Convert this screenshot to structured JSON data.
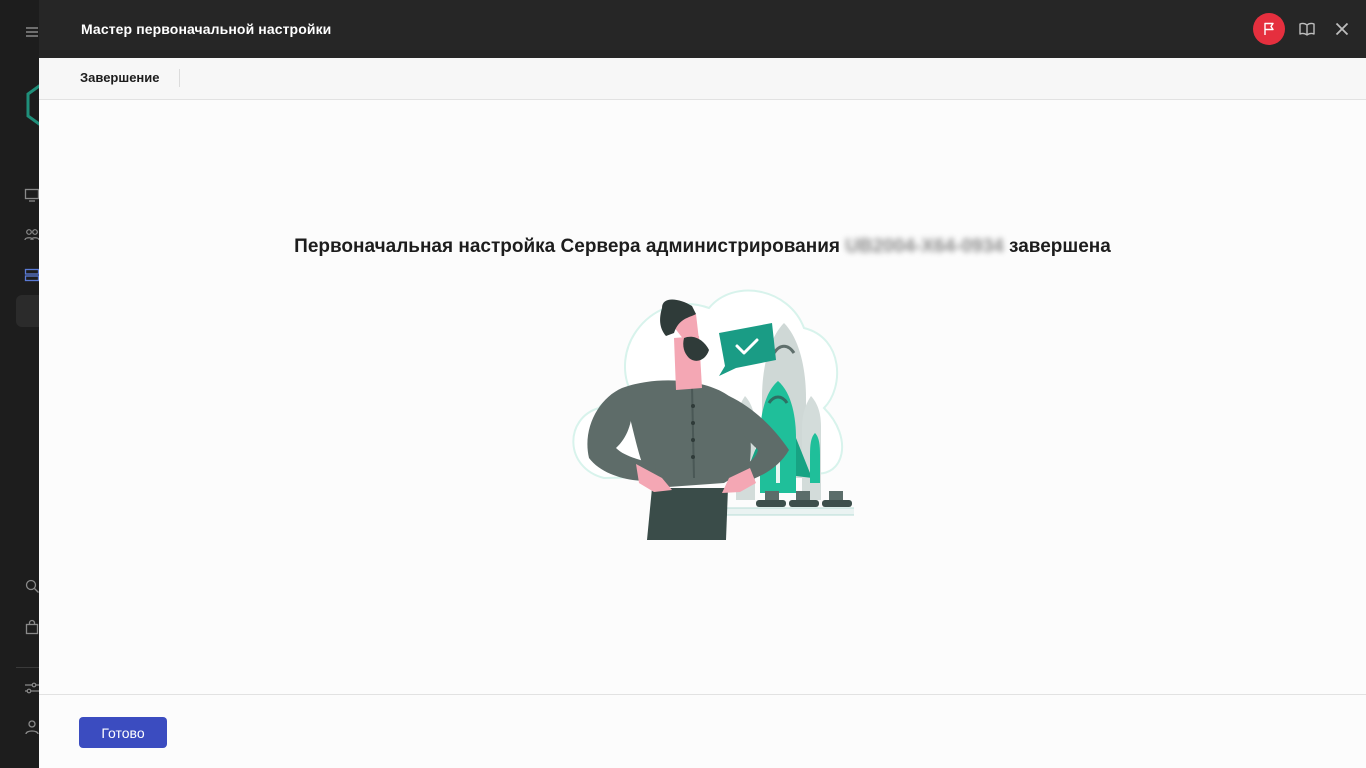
{
  "wizard": {
    "title": "Мастер первоначальной настройки",
    "step": "Завершение",
    "message_prefix": "Первоначальная настройка Сервера администрирования",
    "server_name": "UB2004-X64-0934",
    "message_suffix": "завершена",
    "done_button": "Готово"
  },
  "header_icons": [
    "flag-icon",
    "book-icon",
    "close-icon"
  ],
  "sidebar_icons": [
    "menu-icon",
    "logo-icon",
    "monitor-icon",
    "users-icon",
    "server-icon",
    "search-icon",
    "bag-icon",
    "settings-sliders-icon",
    "user-icon"
  ],
  "colors": {
    "header_bg": "#262626",
    "accent_button": "#3b4cc0",
    "flag_red": "#e52f3e",
    "illustration_green": "#1fbf9a"
  }
}
